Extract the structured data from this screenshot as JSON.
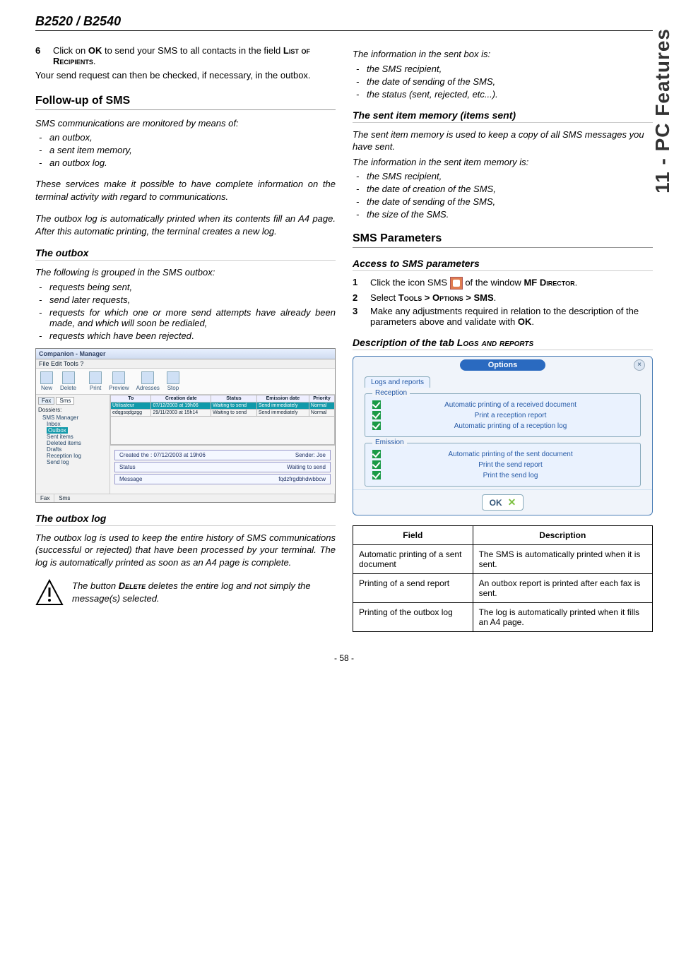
{
  "header": {
    "model": "B2520 / B2540"
  },
  "side_tab": "11 - PC Features",
  "left": {
    "step6": {
      "num": "6",
      "text_a": "Click on ",
      "ok": "OK",
      "text_b": " to send your SMS to all contacts in the field ",
      "field": "List of Recipients",
      "period": "."
    },
    "send_request": "Your send request can then be checked, if necessary, in the outbox.",
    "followup_title": "Follow-up of  SMS",
    "followup_intro": "SMS communications are monitored by means of:",
    "followup_items": [
      "an outbox,",
      "a sent item memory,",
      "an outbox log."
    ],
    "followup_p1": "These services make it possible to have complete information on the terminal activity with regard to communications.",
    "followup_p2": "The outbox log is automatically printed when its contents fill an A4 page. After this automatic printing, the terminal creates a new log.",
    "outbox_title": "The outbox",
    "outbox_intro": "The following is grouped in the SMS outbox:",
    "outbox_items": [
      "requests being sent,",
      "send later requests,",
      "requests for which one or more send attempts have already been made, and which will soon be redialed,",
      "requests which have been rejected"
    ],
    "outbox_items_trail_period": ".",
    "fig": {
      "title": "Companion - Manager",
      "menubar": "File    Edit    Tools    ?",
      "toolbar": [
        "New",
        "Delete",
        "Print",
        "Preview",
        "Adresses",
        "Stop"
      ],
      "side_tabs": [
        "Fax",
        "Sms"
      ],
      "dossiers_label": "Dossiers:",
      "tree": [
        "SMS Manager",
        "Inbox",
        "Outbox",
        "Sent items",
        "Deleted items",
        "Drafts",
        "Reception log",
        "Send log"
      ],
      "grid_headers": [
        "To",
        "Creation date",
        "Status",
        "Emission date",
        "Priority"
      ],
      "grid_rows": [
        [
          "Utilisateur",
          "07/12/2003 at 19h06",
          "Waiting to send",
          "Send immediately",
          "Normal"
        ],
        [
          "edqgsqdgzgg",
          "29/11/2003 at 15h14",
          "Waiting to send",
          "Send immediately",
          "Normal"
        ]
      ],
      "detail_created_label": "Created the : 07/12/2003 at 19h06",
      "detail_sender": "Sender: Joe",
      "detail_status_label": "Status",
      "detail_status_value": "Waiting to send",
      "detail_msg_label": "Message",
      "detail_msg_value": "fqdzfrgdbhdwbbcw",
      "status_left": "Fax",
      "status_right": "Sms"
    },
    "outbox_log_title": "The outbox log",
    "outbox_log_text": "The outbox log is used to keep the entire history of SMS communications (successful or rejected) that have been processed by your terminal. The log is automatically printed as soon as an A4 page is complete.",
    "warn_a": "The button ",
    "warn_delete": "Delete",
    "warn_b": " deletes the entire log and not simply the message(s) selected."
  },
  "right": {
    "sent_box_intro": "The information in the sent box is:",
    "sent_box_items": [
      "the SMS recipient,",
      "the date of sending of the SMS,",
      "the status (sent, rejected, etc...)."
    ],
    "sent_mem_title": "The sent item memory (items sent)",
    "sent_mem_p1": "The sent item memory is used to keep a copy of all SMS messages you have sent.",
    "sent_mem_p2": "The information in the sent item memory is:",
    "sent_mem_items": [
      "the SMS recipient,",
      "the date of creation of the SMS,",
      "the date of sending of the SMS,",
      "the size of the SMS."
    ],
    "sms_params_title": "SMS Parameters",
    "access_title": "Access to SMS parameters",
    "steps": [
      {
        "num": "1",
        "a": "Click the icon SMS ",
        "b": " of the window ",
        "mf": "MF",
        "dir": "Director",
        "period": "."
      },
      {
        "num": "2",
        "a": "Select ",
        "tools": "Tools > Options > SMS",
        "period": "."
      },
      {
        "num": "3",
        "a": "Make any adjustments required in relation to the description of the parameters above and validate with ",
        "ok": "OK",
        "period": "."
      }
    ],
    "desc_title_a": "Description of the tab ",
    "desc_title_b": "Logs and reports",
    "options": {
      "title": "Options",
      "tab": "Logs and reports",
      "reception_legend": "Reception",
      "reception_rows": [
        "Automatic printing of a received document",
        "Print a reception report",
        "Automatic printing of a reception log"
      ],
      "emission_legend": "Emission",
      "emission_rows": [
        "Automatic printing of the sent document",
        "Print the send report",
        "Print the send log"
      ],
      "ok": "OK"
    },
    "table": {
      "h1": "Field",
      "h2": "Description",
      "rows": [
        {
          "f": "Automatic printing of a sent document",
          "d": "The SMS is automatically printed when it is sent."
        },
        {
          "f": "Printing of a send report",
          "d": "An outbox report is printed after each fax is sent."
        },
        {
          "f": "Printing of the outbox log",
          "d": "The log is automatically printed when it fills an A4 page."
        }
      ]
    }
  },
  "footer": "- 58 -"
}
